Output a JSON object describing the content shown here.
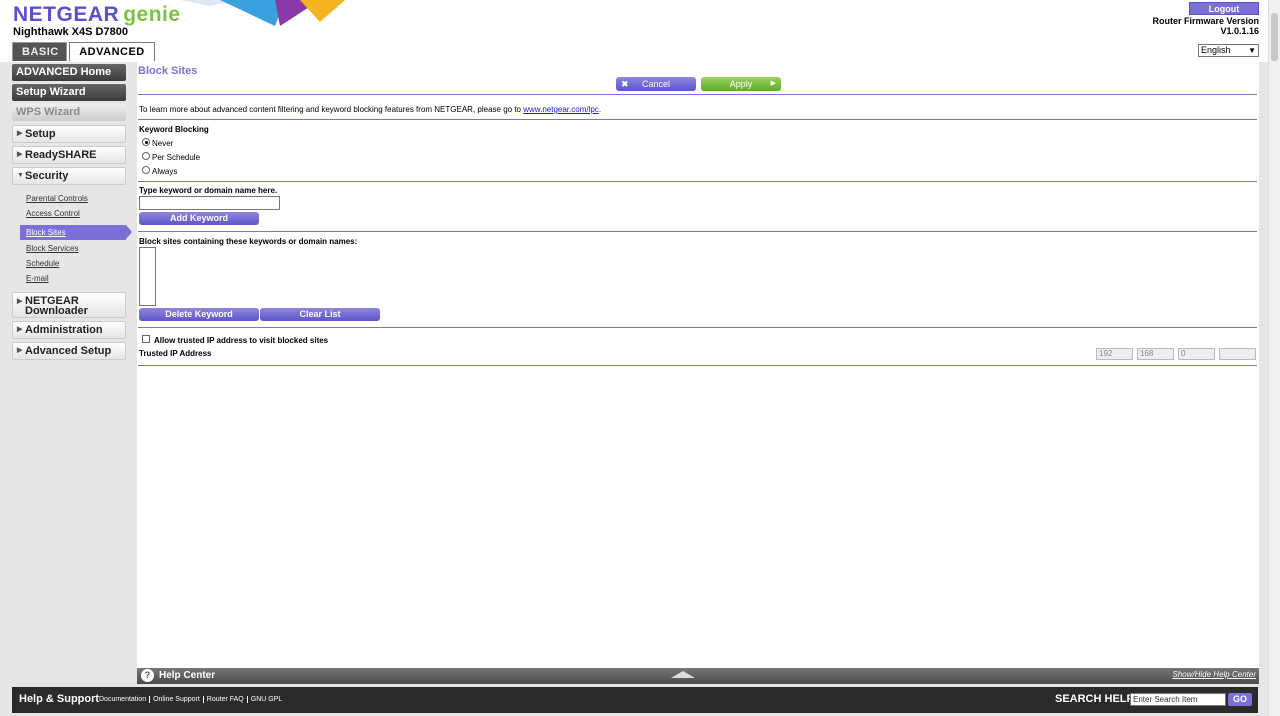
{
  "header": {
    "brand_left": "NETGEAR",
    "brand_right": "genie",
    "model": "Nighthawk X4S D7800",
    "tabs": [
      {
        "label": "BASIC"
      },
      {
        "label": "ADVANCED"
      }
    ],
    "logout_label": "Logout",
    "firmware_label": "Router Firmware Version",
    "firmware_version": "V1.0.1.16",
    "language": "English"
  },
  "sidebar": {
    "buttons": [
      {
        "label": "ADVANCED Home"
      },
      {
        "label": "Setup Wizard"
      },
      {
        "label": "WPS Wizard"
      }
    ],
    "groups": [
      {
        "label": "Setup"
      },
      {
        "label": "ReadySHARE"
      },
      {
        "label": "Security"
      },
      {
        "label": "NETGEAR Downloader"
      },
      {
        "label": "Administration"
      },
      {
        "label": "Advanced Setup"
      }
    ],
    "security_items": [
      {
        "label": "Parental Controls"
      },
      {
        "label": "Access Control"
      },
      {
        "label": "Block Sites"
      },
      {
        "label": "Block Services"
      },
      {
        "label": "Schedule"
      },
      {
        "label": "E-mail"
      }
    ]
  },
  "main": {
    "title": "Block Sites",
    "cancel_label": "Cancel",
    "apply_label": "Apply",
    "info_text": "To learn more about advanced content filtering and keyword blocking features from NETGEAR, please go to ",
    "info_link": "www.netgear.com/lpc",
    "info_end": ".",
    "keyword_blocking_label": "Keyword Blocking",
    "radio_options": [
      {
        "label": "Never"
      },
      {
        "label": "Per Schedule"
      },
      {
        "label": "Always"
      }
    ],
    "selected_option": "Never",
    "type_keyword_label": "Type keyword or domain name here.",
    "keyword_input_value": "",
    "add_keyword_label": "Add Keyword",
    "block_list_label": "Block sites containing these keywords or domain names:",
    "delete_keyword_label": "Delete Keyword",
    "clear_list_label": "Clear List",
    "allow_trusted_label": "Allow trusted IP address to visit blocked sites",
    "trusted_ip_label": "Trusted IP Address",
    "trusted_ip": [
      "192",
      "168",
      "0",
      ""
    ]
  },
  "help_center": {
    "label": "Help Center",
    "toggle_label": "Show/Hide Help Center"
  },
  "footer": {
    "title": "Help & Support",
    "links": [
      {
        "label": "Documentation"
      },
      {
        "label": "Online Support"
      },
      {
        "label": "Router FAQ"
      },
      {
        "label": "GNU GPL"
      }
    ],
    "search_label": "SEARCH HELP",
    "search_placeholder": "Enter Search Item",
    "go_label": "GO"
  },
  "colors": {
    "accent": "#7a70d8",
    "apply_green": "#7cc242",
    "sidebar_dark": "#3b3b3b"
  }
}
